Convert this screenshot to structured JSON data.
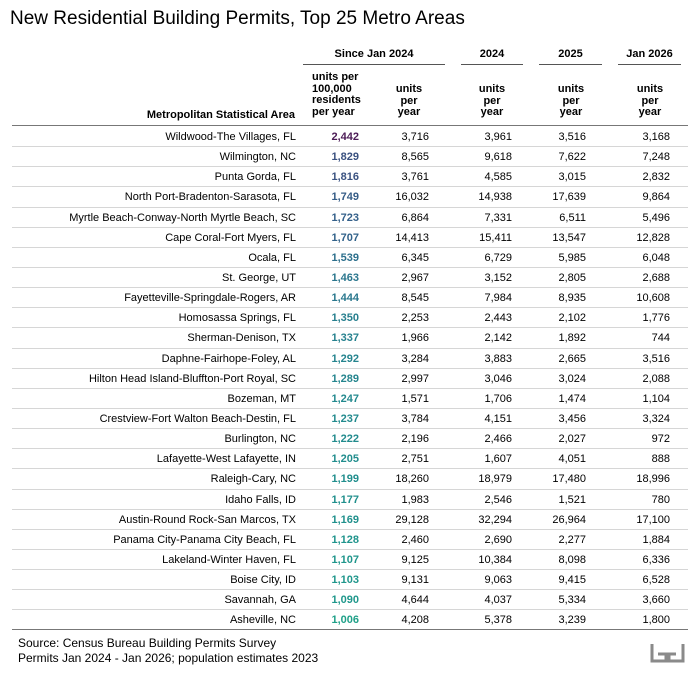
{
  "title": "New Residential Building Permits, Top 25 Metro Areas",
  "header": {
    "groups": [
      "Since Jan 2024",
      "2024",
      "2025",
      "Jan 2026"
    ],
    "sub": {
      "rate": "units per\n100,000\nresidents\nper year",
      "units": "units\nper\nyear"
    },
    "msa": "Metropolitan Statistical Area"
  },
  "rows": [
    {
      "name": "Wildwood-The Villages, FL",
      "rate": "2,442",
      "since": "3,716",
      "y2024": "3,961",
      "y2025": "3,516",
      "jan2026": "3,168",
      "color": "#4b1a55"
    },
    {
      "name": "Wilmington, NC",
      "rate": "1,829",
      "since": "8,565",
      "y2024": "9,618",
      "y2025": "7,622",
      "jan2026": "7,248",
      "color": "#39507f"
    },
    {
      "name": "Punta Gorda, FL",
      "rate": "1,816",
      "since": "3,761",
      "y2024": "4,585",
      "y2025": "3,015",
      "jan2026": "2,832",
      "color": "#3a5280"
    },
    {
      "name": "North Port-Bradenton-Sarasota, FL",
      "rate": "1,749",
      "since": "16,032",
      "y2024": "14,938",
      "y2025": "17,639",
      "jan2026": "9,864",
      "color": "#355c86"
    },
    {
      "name": "Myrtle Beach-Conway-North Myrtle Beach, SC",
      "rate": "1,723",
      "since": "6,864",
      "y2024": "7,331",
      "y2025": "6,511",
      "jan2026": "5,496",
      "color": "#34608a"
    },
    {
      "name": "Cape Coral-Fort Myers, FL",
      "rate": "1,707",
      "since": "14,413",
      "y2024": "15,411",
      "y2025": "13,547",
      "jan2026": "12,828",
      "color": "#32628a"
    },
    {
      "name": "Ocala, FL",
      "rate": "1,539",
      "since": "6,345",
      "y2024": "6,729",
      "y2025": "5,985",
      "jan2026": "6,048",
      "color": "#2c6f8c"
    },
    {
      "name": "St. George, UT",
      "rate": "1,463",
      "since": "2,967",
      "y2024": "3,152",
      "y2025": "2,805",
      "jan2026": "2,688",
      "color": "#2a768d"
    },
    {
      "name": "Fayetteville-Springdale-Rogers, AR",
      "rate": "1,444",
      "since": "8,545",
      "y2024": "7,984",
      "y2025": "8,935",
      "jan2026": "10,608",
      "color": "#29778d"
    },
    {
      "name": "Homosassa Springs, FL",
      "rate": "1,350",
      "since": "2,253",
      "y2024": "2,443",
      "y2025": "2,102",
      "jan2026": "1,776",
      "color": "#277f8e"
    },
    {
      "name": "Sherman-Denison, TX",
      "rate": "1,337",
      "since": "1,966",
      "y2024": "2,142",
      "y2025": "1,892",
      "jan2026": "744",
      "color": "#26818e"
    },
    {
      "name": "Daphne-Fairhope-Foley, AL",
      "rate": "1,292",
      "since": "3,284",
      "y2024": "3,883",
      "y2025": "2,665",
      "jan2026": "3,516",
      "color": "#25848e"
    },
    {
      "name": "Hilton Head Island-Bluffton-Port Royal, SC",
      "rate": "1,289",
      "since": "2,997",
      "y2024": "3,046",
      "y2025": "3,024",
      "jan2026": "2,088",
      "color": "#25858e"
    },
    {
      "name": "Bozeman, MT",
      "rate": "1,247",
      "since": "1,571",
      "y2024": "1,706",
      "y2025": "1,474",
      "jan2026": "1,104",
      "color": "#23898e"
    },
    {
      "name": "Crestview-Fort Walton Beach-Destin, FL",
      "rate": "1,237",
      "since": "3,784",
      "y2024": "4,151",
      "y2025": "3,456",
      "jan2026": "3,324",
      "color": "#228a8d"
    },
    {
      "name": "Burlington, NC",
      "rate": "1,222",
      "since": "2,196",
      "y2024": "2,466",
      "y2025": "2,027",
      "jan2026": "972",
      "color": "#228b8d"
    },
    {
      "name": "Lafayette-West Lafayette, IN",
      "rate": "1,205",
      "since": "2,751",
      "y2024": "1,607",
      "y2025": "4,051",
      "jan2026": "888",
      "color": "#218d8d"
    },
    {
      "name": "Raleigh-Cary, NC",
      "rate": "1,199",
      "since": "18,260",
      "y2024": "18,979",
      "y2025": "17,480",
      "jan2026": "18,996",
      "color": "#218e8d"
    },
    {
      "name": "Idaho Falls, ID",
      "rate": "1,177",
      "since": "1,983",
      "y2024": "2,546",
      "y2025": "1,521",
      "jan2026": "780",
      "color": "#208f8c"
    },
    {
      "name": "Austin-Round Rock-San Marcos, TX",
      "rate": "1,169",
      "since": "29,128",
      "y2024": "32,294",
      "y2025": "26,964",
      "jan2026": "17,100",
      "color": "#20908c"
    },
    {
      "name": "Panama City-Panama City Beach, FL",
      "rate": "1,128",
      "since": "2,460",
      "y2024": "2,690",
      "y2025": "2,277",
      "jan2026": "1,884",
      "color": "#1f948c"
    },
    {
      "name": "Lakeland-Winter Haven, FL",
      "rate": "1,107",
      "since": "9,125",
      "y2024": "10,384",
      "y2025": "8,098",
      "jan2026": "6,336",
      "color": "#1f958b"
    },
    {
      "name": "Boise City, ID",
      "rate": "1,103",
      "since": "9,131",
      "y2024": "9,063",
      "y2025": "9,415",
      "jan2026": "6,528",
      "color": "#1f968b"
    },
    {
      "name": "Savannah, GA",
      "rate": "1,090",
      "since": "4,644",
      "y2024": "4,037",
      "y2025": "5,334",
      "jan2026": "3,660",
      "color": "#1f978b"
    },
    {
      "name": "Asheville, NC",
      "rate": "1,006",
      "since": "4,208",
      "y2024": "5,378",
      "y2025": "3,239",
      "jan2026": "1,800",
      "color": "#1fa088"
    }
  ],
  "footer": {
    "line1": "Source: Census Bureau Building Permits Survey",
    "line2": "Permits Jan 2024 - Jan 2026; population estimates 2023"
  },
  "logo": {
    "icon": "publisher-logo-icon",
    "color": "#8a8a8a"
  }
}
